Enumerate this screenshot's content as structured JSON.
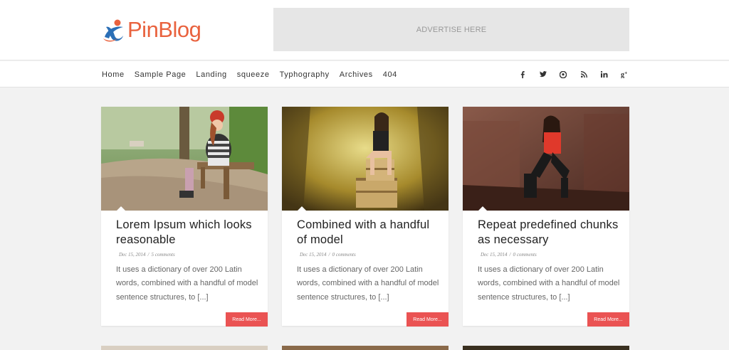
{
  "site": {
    "logo_text": "PinBlog",
    "ad_text": "ADVERTISE HERE"
  },
  "nav": {
    "items": [
      "Home",
      "Sample Page",
      "Landing",
      "squeeze",
      "Typhography",
      "Archives",
      "404"
    ]
  },
  "social": {
    "icons": [
      {
        "name": "facebook-icon",
        "glyph": "f"
      },
      {
        "name": "twitter-icon",
        "glyph": "t"
      },
      {
        "name": "pinterest-icon",
        "glyph": "p"
      },
      {
        "name": "rss-icon",
        "glyph": "rss"
      },
      {
        "name": "linkedin-icon",
        "glyph": "in"
      },
      {
        "name": "google-plus-icon",
        "glyph": "g+"
      }
    ]
  },
  "posts": [
    {
      "title": "Lorem Ipsum which looks reasonable",
      "date": "Dec 15, 2014",
      "comments": "5 comments",
      "excerpt": "It uses a dictionary of over 200 Latin words, combined with a handful of model sentence structures, to [...]",
      "read_more": "Read More..."
    },
    {
      "title": "Combined with a handful of model",
      "date": "Dec 15, 2014",
      "comments": "0 comments",
      "excerpt": "It uses a dictionary of over 200 Latin words, combined with a handful of model sentence structures, to [...]",
      "read_more": "Read More..."
    },
    {
      "title": "Repeat predefined chunks as necessary",
      "date": "Dec 15, 2014",
      "comments": "0 comments",
      "excerpt": "It uses a dictionary of over 200 Latin words, combined with a handful of model sentence structures, to [...]",
      "read_more": "Read More..."
    }
  ],
  "colors": {
    "brand": "#e9623e",
    "accent": "#ea5353",
    "logo_blue": "#2b6fb6"
  }
}
